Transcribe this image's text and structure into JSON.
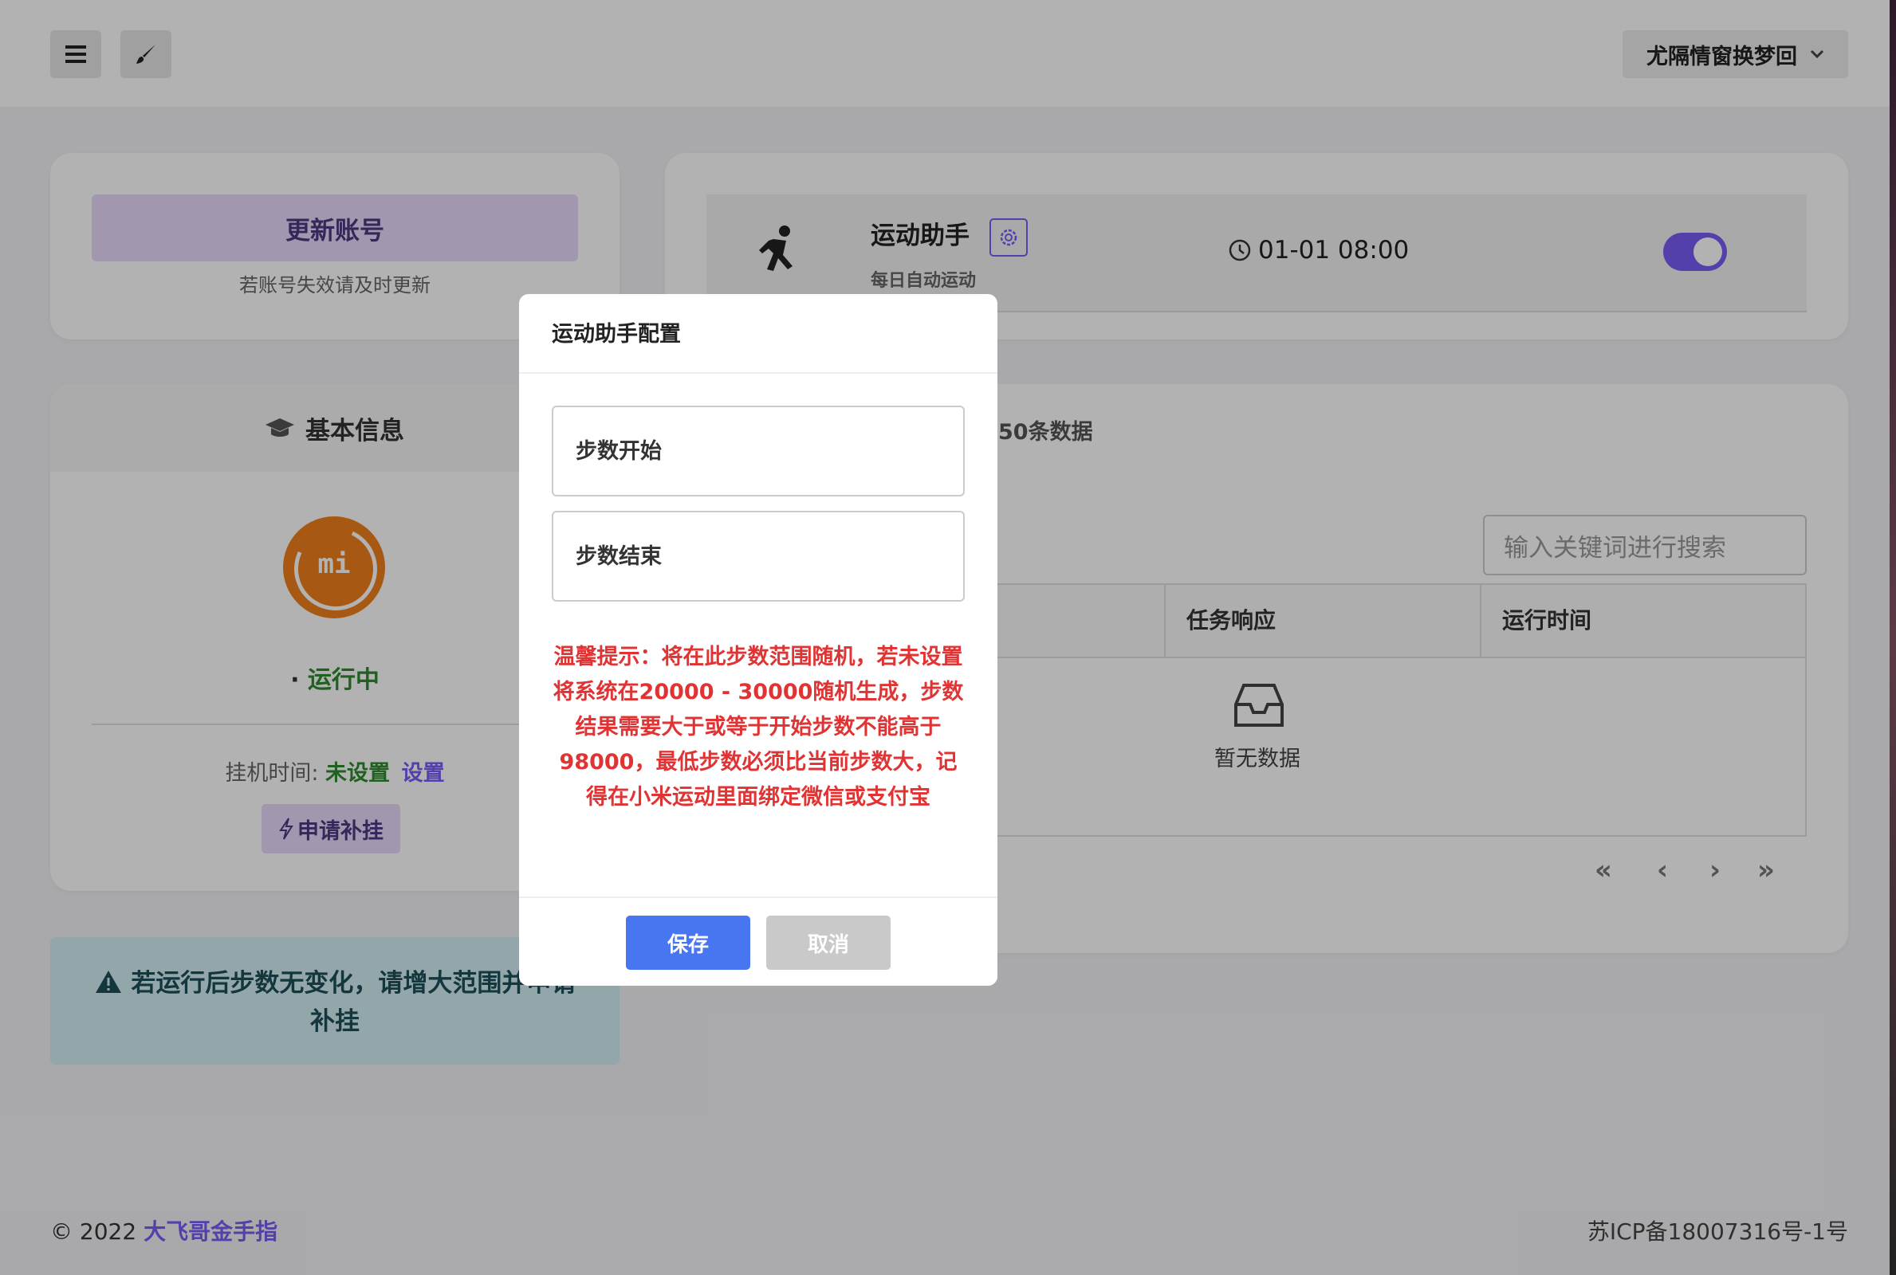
{
  "header": {
    "menu_icon": "hamburger-icon",
    "brush_icon": "brush-icon",
    "username": "尤隔情窗换梦回"
  },
  "account_card": {
    "update_button": "更新账号",
    "hint": "若账号失效请及时更新"
  },
  "sport_card": {
    "icon": "running-icon",
    "title": "运动助手",
    "subtitle": "每日自动运动",
    "time": "01-01 08:00",
    "toggle_on": true
  },
  "basic_info": {
    "title": "基本信息",
    "logo_text": "mi",
    "status_prefix": "·",
    "status": "运行中",
    "hang_time_label": "挂机时间:",
    "hang_time_value": "未设置",
    "settings_link": "设置",
    "apply_button": "申请补挂"
  },
  "alert": {
    "text": "若运行后步数无变化，请增大范围并申请补挂"
  },
  "records": {
    "title_suffix": "50条数据",
    "search_placeholder": "输入关键词进行搜索",
    "columns": [
      "任务响应",
      "运行时间"
    ],
    "empty_text": "暂无数据",
    "pager": [
      "«",
      "‹",
      "›",
      "»"
    ]
  },
  "modal": {
    "title": "运动助手配置",
    "step_start_placeholder": "步数开始",
    "step_end_placeholder": "步数结束",
    "warning": "温馨提示：将在此步数范围随机，若未设置将系统在20000 - 30000随机生成，步数结果需要大于或等于开始步数不能高于98000，最低步数必须比当前步数大，记得在小米运动里面绑定微信或支付宝",
    "save_button": "保存",
    "cancel_button": "取消"
  },
  "footer": {
    "copyright": "© 2022",
    "brand": "大飞哥金手指",
    "icp": "苏ICP备18007316号-1号"
  },
  "colors": {
    "accent": "#7a5cf5",
    "save": "#4776f0",
    "warning": "#e03333",
    "status": "#2f8a2f"
  }
}
